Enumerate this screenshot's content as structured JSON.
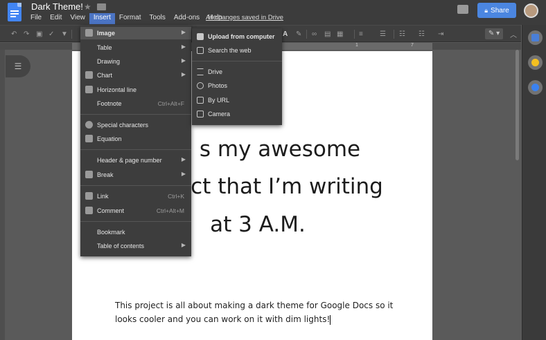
{
  "app": {
    "doc_title": "Dark Theme!",
    "saved_status": "All changes saved in Drive",
    "share_label": "Share"
  },
  "menu": [
    {
      "label": "File"
    },
    {
      "label": "Edit"
    },
    {
      "label": "View"
    },
    {
      "label": "Insert",
      "active": true
    },
    {
      "label": "Format"
    },
    {
      "label": "Tools"
    },
    {
      "label": "Add-ons"
    },
    {
      "label": "Help"
    }
  ],
  "insert_menu": {
    "image": {
      "label": "Image"
    },
    "table": {
      "label": "Table"
    },
    "drawing": {
      "label": "Drawing"
    },
    "chart": {
      "label": "Chart"
    },
    "horizontal_line": {
      "label": "Horizontal line"
    },
    "footnote": {
      "label": "Footnote",
      "shortcut": "Ctrl+Alt+F"
    },
    "special_characters": {
      "label": "Special characters"
    },
    "equation": {
      "label": "Equation"
    },
    "header_page_number": {
      "label": "Header & page number"
    },
    "break": {
      "label": "Break"
    },
    "link": {
      "label": "Link",
      "shortcut": "Ctrl+K"
    },
    "comment": {
      "label": "Comment",
      "shortcut": "Ctrl+Alt+M"
    },
    "bookmark": {
      "label": "Bookmark"
    },
    "table_of_contents": {
      "label": "Table of contents"
    }
  },
  "image_submenu": {
    "upload": "Upload from computer",
    "search_web": "Search the web",
    "drive": "Drive",
    "photos": "Photos",
    "by_url": "By URL",
    "camera": "Camera"
  },
  "document": {
    "heading_lines": [
      "s my awesome",
      "ct that I’m writing",
      "at 3 A.M."
    ],
    "body_text": "This project is all about making a dark theme for Google Docs so it looks cooler and you can work on it with dim lights!"
  },
  "ruler": {
    "marks": [
      "1",
      "7"
    ]
  },
  "colors": {
    "menu_bg": "#3d3d3d",
    "header_bg": "#3c3c3c",
    "accent": "#4b86e0",
    "page": "#ffffff"
  },
  "icons": {
    "side_calendar": "calendar-icon",
    "side_keep": "keep-icon",
    "side_tasks": "tasks-icon"
  }
}
